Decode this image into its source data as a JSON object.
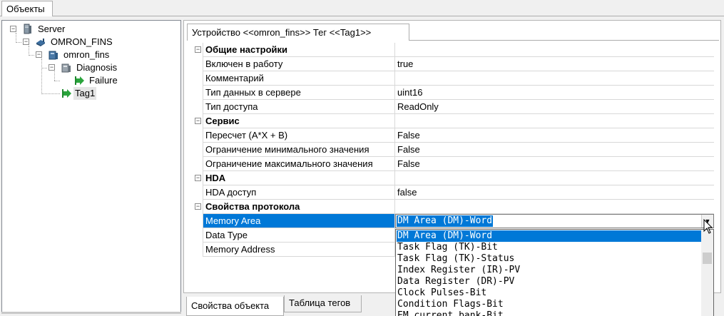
{
  "top_tab": "Объекты",
  "tree": [
    {
      "label": "Server",
      "icon": "server-icon"
    },
    {
      "label": "OMRON_FINS",
      "icon": "channel-icon"
    },
    {
      "label": "omron_fins",
      "icon": "device-icon"
    },
    {
      "label": "Diagnosis",
      "icon": "folder-icon"
    },
    {
      "label": "Failure",
      "icon": "tag-arrow-icon"
    },
    {
      "label": "Tag1",
      "icon": "tag-arrow-icon"
    }
  ],
  "property_tab": "Устройство <<omron_fins>> Тег  <<Tag1>>",
  "properties": {
    "cat_general": "Общие настройки",
    "enabled": {
      "name": "Включен в работу",
      "value": "true"
    },
    "comment": {
      "name": "Комментарий",
      "value": ""
    },
    "data_type_server": {
      "name": "Тип данных в сервере",
      "value": "uint16"
    },
    "access_type": {
      "name": "Тип доступа",
      "value": "ReadOnly"
    },
    "cat_service": "Сервис",
    "recalc": {
      "name": "Пересчет (A*X + B)",
      "value": "False"
    },
    "min_limit": {
      "name": "Ограничение минимального значения",
      "value": "False"
    },
    "max_limit": {
      "name": "Ограничение максимального значения",
      "value": "False"
    },
    "cat_hda": "HDA",
    "hda_access": {
      "name": "HDA доступ",
      "value": "false"
    },
    "cat_protocol": "Свойства протокола",
    "memory_area": {
      "name": "Memory Area",
      "value": "DM Area (DM)-Word"
    },
    "data_type": {
      "name": "Data Type",
      "value": ""
    },
    "memory_address": {
      "name": "Memory Address",
      "value": ""
    }
  },
  "dropdown": {
    "options": [
      "DM Area (DM)-Word",
      "Task Flag (TK)-Bit",
      "Task Flag (TK)-Status",
      "Index Register (IR)-PV",
      "Data Register (DR)-PV",
      "Clock Pulses-Bit",
      "Condition Flags-Bit",
      "EM current bank-Bit"
    ]
  },
  "bottom_tabs": [
    "Свойства объекта",
    "Таблица тегов"
  ],
  "colors": {
    "selection": "#0078d7"
  }
}
